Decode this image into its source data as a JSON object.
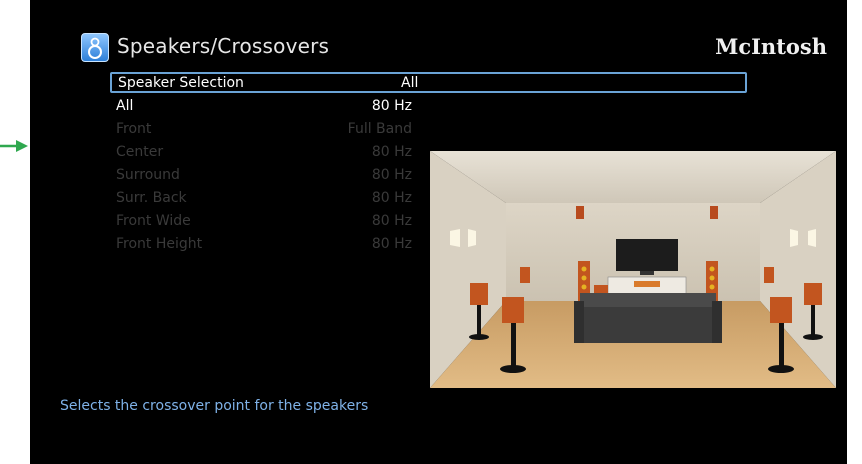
{
  "header": {
    "title": "Speakers/Crossovers",
    "brand": "McIntosh"
  },
  "selector": {
    "label": "Speaker Selection",
    "value": "All"
  },
  "rows": [
    {
      "label": "All",
      "value": "80 Hz",
      "enabled": true
    },
    {
      "label": "Front",
      "value": "Full Band",
      "enabled": false
    },
    {
      "label": "Center",
      "value": "80 Hz",
      "enabled": false
    },
    {
      "label": "Surround",
      "value": "80 Hz",
      "enabled": false
    },
    {
      "label": "Surr. Back",
      "value": "80 Hz",
      "enabled": false
    },
    {
      "label": "Front Wide",
      "value": "80 Hz",
      "enabled": false
    },
    {
      "label": "Front Height",
      "value": "80 Hz",
      "enabled": false
    }
  ],
  "footer": {
    "hint": "Selects the crossover point for the speakers"
  },
  "colors": {
    "accent_text": "#7fb2e8",
    "selection_border": "#6aa3d6",
    "pointer_arrow": "#2fa84f"
  },
  "icons": {
    "title": "speaker-icon",
    "pointer": "green-arrow-icon"
  }
}
